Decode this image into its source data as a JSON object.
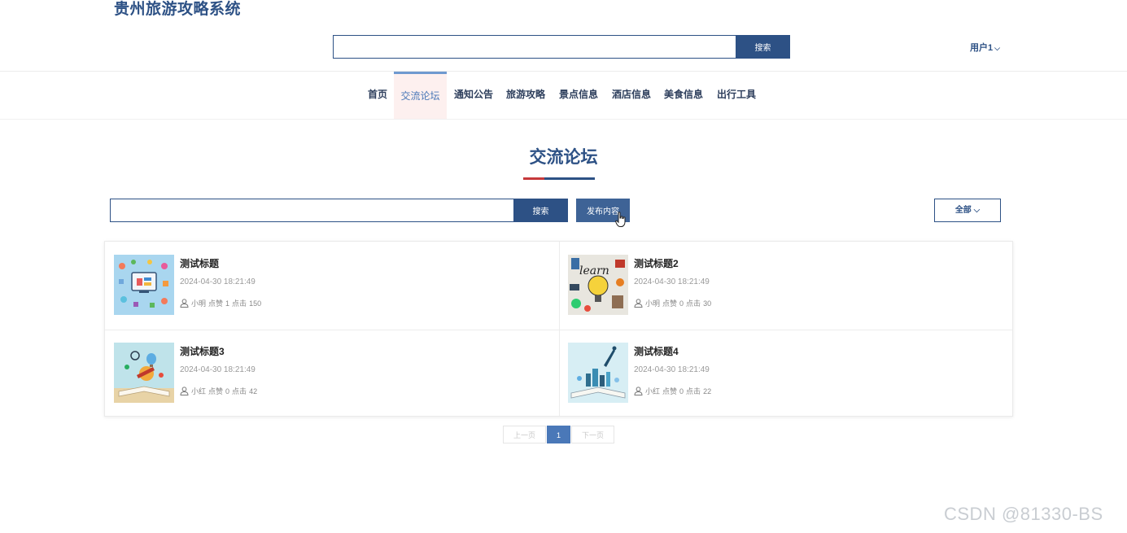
{
  "site": {
    "title": "贵州旅游攻略系统"
  },
  "header": {
    "search_button": "搜索",
    "user_label": "用户1",
    "user_chevron": "⌵"
  },
  "nav": {
    "items": [
      {
        "label": "首页"
      },
      {
        "label": "交流论坛"
      },
      {
        "label": "通知公告"
      },
      {
        "label": "旅游攻略"
      },
      {
        "label": "景点信息"
      },
      {
        "label": "酒店信息"
      },
      {
        "label": "美食信息"
      },
      {
        "label": "出行工具"
      }
    ],
    "active": "交流论坛"
  },
  "section": {
    "title": "交流论坛"
  },
  "toolbar": {
    "search_button": "搜索",
    "publish_button": "发布内容",
    "filter_label": "全部",
    "filter_chevron": "⌵"
  },
  "posts": [
    {
      "title": "测试标题",
      "date": "2024-04-30 18:21:49",
      "author": "小明",
      "likes_label": "点赞",
      "likes": "1",
      "clicks_label": "点击",
      "clicks": "150"
    },
    {
      "title": "测试标题2",
      "date": "2024-04-30 18:21:49",
      "author": "小明",
      "likes_label": "点赞",
      "likes": "0",
      "clicks_label": "点击",
      "clicks": "30"
    },
    {
      "title": "测试标题3",
      "date": "2024-04-30 18:21:49",
      "author": "小红",
      "likes_label": "点赞",
      "likes": "0",
      "clicks_label": "点击",
      "clicks": "42"
    },
    {
      "title": "测试标题4",
      "date": "2024-04-30 18:21:49",
      "author": "小红",
      "likes_label": "点赞",
      "likes": "0",
      "clicks_label": "点击",
      "clicks": "22"
    }
  ],
  "pagination": {
    "prev": "上一页",
    "current": "1",
    "next": "下一页"
  },
  "watermark": "CSDN @81330-BS",
  "colors": {
    "primary": "#2d5185",
    "accent_red": "#c6393b",
    "active_tab_bg": "#fdf0ef",
    "page_active": "#4a78b8"
  }
}
